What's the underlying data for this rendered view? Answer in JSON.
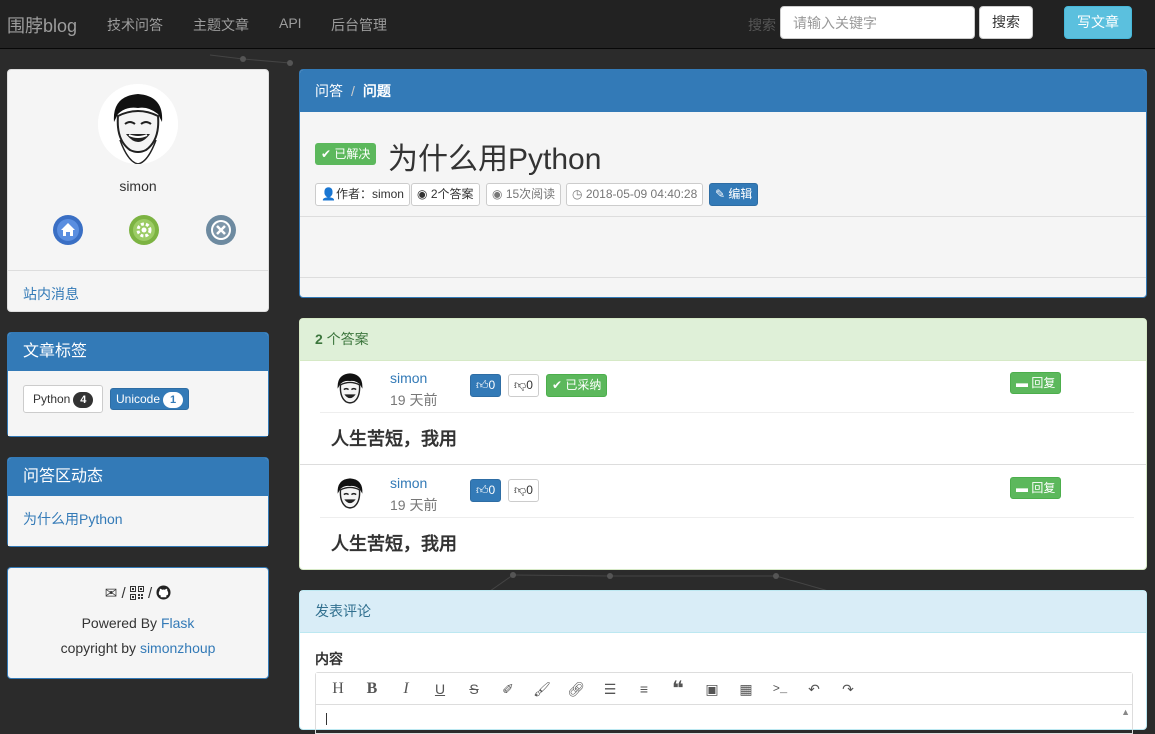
{
  "navbar": {
    "brand": "围脖blog",
    "links": [
      "技术问答",
      "主题文章",
      "API",
      "后台管理"
    ],
    "search_label": "搜索",
    "search_placeholder": "请输入关键字",
    "search_button": "搜索",
    "write_button": "写文章"
  },
  "profile": {
    "username": "simon",
    "icons": [
      "home-icon",
      "settings-icon",
      "close-icon"
    ],
    "message_link": "站内消息"
  },
  "tags_panel": {
    "title": "文章标签",
    "tags": [
      {
        "name": "Python",
        "count": "4"
      },
      {
        "name": "Unicode",
        "count": "1"
      }
    ]
  },
  "qa_panel": {
    "title": "问答区动态",
    "items": [
      "为什么用Python"
    ]
  },
  "footer": {
    "icon_sep": "/",
    "powered_prefix": "Powered By ",
    "powered_link": "Flask",
    "copyright_prefix": "copyright by ",
    "copyright_link": "simonzhoup"
  },
  "question": {
    "breadcrumb": [
      "问答",
      "问题"
    ],
    "breadcrumb_sep": "/",
    "status": "已解决",
    "title": "为什么用Python",
    "author": "作者：simon",
    "answers": "2个答案",
    "views": "15次阅读",
    "time": "2018-05-09 04:40:28",
    "edit": "编辑"
  },
  "answers": {
    "count": "2",
    "count_label": " 个答案",
    "items": [
      {
        "user": "simon",
        "time": "19 天前",
        "up": "0",
        "down": "0",
        "adopted": "已采纳",
        "reply": "回复",
        "content": "人生苦短，我用"
      },
      {
        "user": "simon",
        "time": "19 天前",
        "up": "0",
        "down": "0",
        "reply": "回复",
        "content": "人生苦短，我用"
      }
    ]
  },
  "comment": {
    "title": "发表评论",
    "content_label": "内容",
    "toolbar": [
      "heading-icon",
      "bold-icon",
      "italic-icon",
      "underline-icon",
      "strikethrough-icon",
      "highlight-icon",
      "brush-icon",
      "link-icon",
      "list-icon",
      "align-icon",
      "quote-icon",
      "image-icon",
      "table-icon",
      "code-icon",
      "undo-icon",
      "redo-icon"
    ]
  },
  "colors": {
    "primary": "#337ab7",
    "success": "#5cb85c",
    "info": "#5bc0de",
    "navbar": "#222222"
  }
}
